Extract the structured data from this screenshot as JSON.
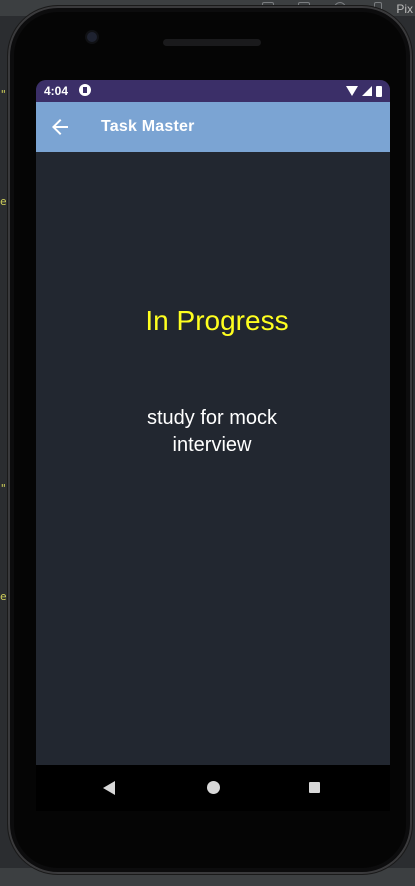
{
  "ide": {
    "right_label": "Pix",
    "side_quote": "\"",
    "side_marks": [
      "e\"",
      "e\""
    ]
  },
  "status_bar": {
    "time": "4:04"
  },
  "app_bar": {
    "title": "Task Master",
    "back_icon": "arrow-back-icon",
    "background_color": "#7ba4d3"
  },
  "task": {
    "state": "In Progress",
    "title": "study for mock interview",
    "state_color": "#ffff1f"
  },
  "nav_bar": {
    "back_icon": "triangle-back-icon",
    "home_icon": "circle-home-icon",
    "recents_icon": "square-recents-icon"
  }
}
